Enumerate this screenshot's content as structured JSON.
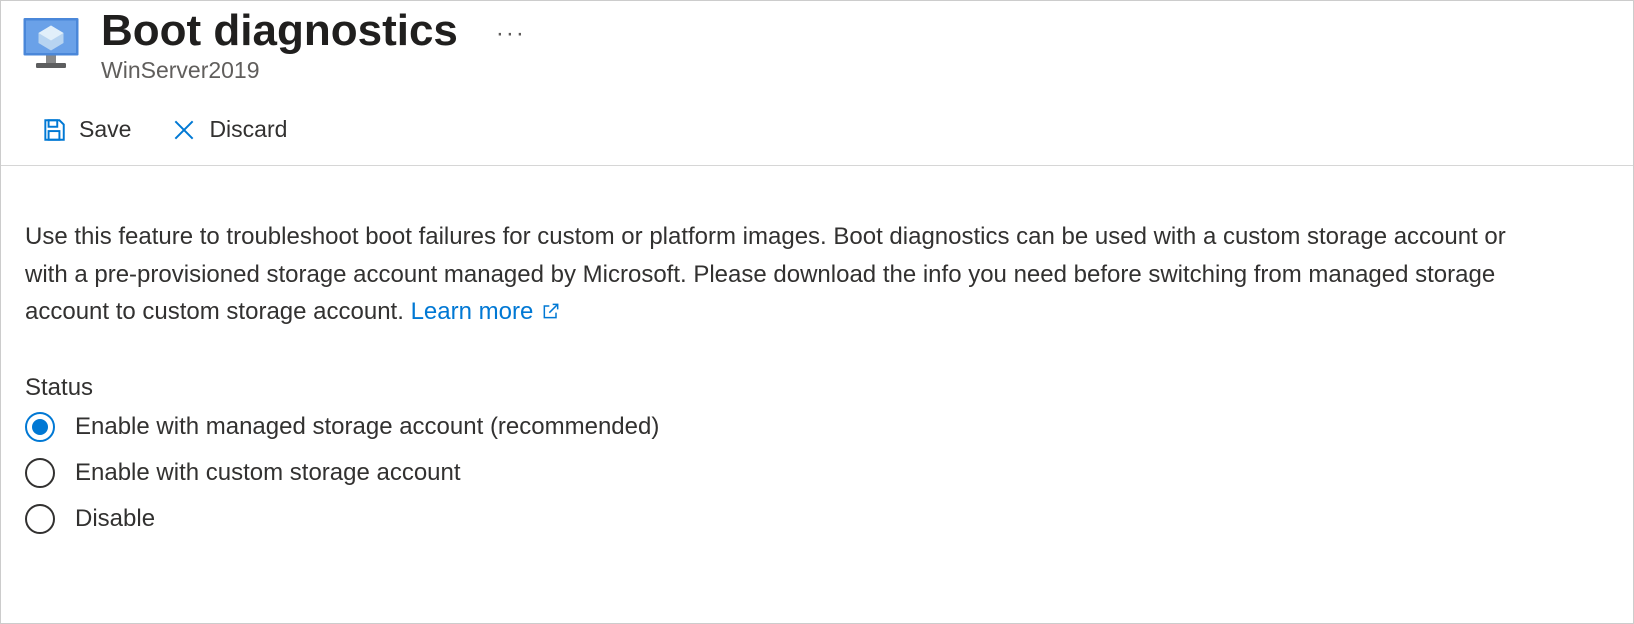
{
  "header": {
    "title": "Boot diagnostics",
    "subtitle": "WinServer2019"
  },
  "toolbar": {
    "save_label": "Save",
    "discard_label": "Discard"
  },
  "description": {
    "body": "Use this feature to troubleshoot boot failures for custom or platform images. Boot diagnostics can be used with a custom storage account or with a pre-provisioned storage account managed by Microsoft. Please download the info you need before switching from managed storage account to custom storage account.",
    "learn_more_label": "Learn more"
  },
  "status": {
    "label": "Status",
    "options": [
      {
        "label": "Enable with managed storage account (recommended)",
        "selected": true
      },
      {
        "label": "Enable with custom storage account",
        "selected": false
      },
      {
        "label": "Disable",
        "selected": false
      }
    ]
  },
  "colors": {
    "accent": "#0078d4"
  }
}
